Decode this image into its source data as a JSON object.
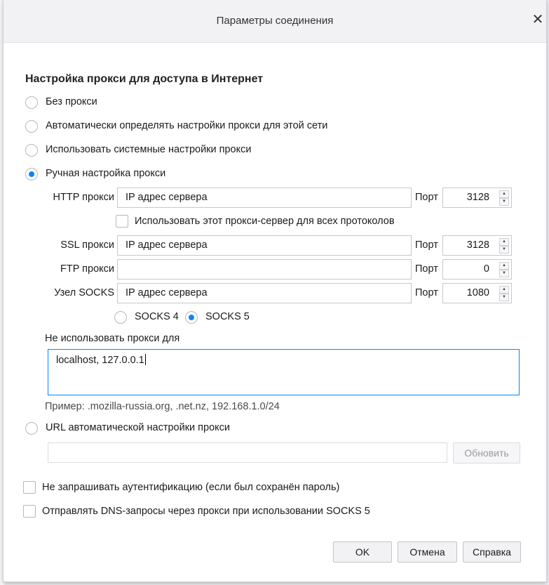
{
  "dialog": {
    "title": "Параметры соединения",
    "close": "✕"
  },
  "heading": "Настройка прокси для доступа в Интернет",
  "proxy_modes": [
    {
      "label": "Без прокси",
      "checked": false
    },
    {
      "label": "Автоматически определять настройки прокси для этой сети",
      "checked": false
    },
    {
      "label": "Использовать системные настройки прокси",
      "checked": false
    },
    {
      "label": "Ручная настройка прокси",
      "checked": true
    }
  ],
  "manual": {
    "http": {
      "label": "HTTP прокси",
      "value": "IP адрес сервера",
      "port_label": "Порт",
      "port": "3128"
    },
    "share_all": {
      "label": "Использовать этот прокси-сервер для всех протоколов",
      "checked": false
    },
    "ssl": {
      "label": "SSL прокси",
      "value": "IP адрес сервера",
      "port_label": "Порт",
      "port": "3128"
    },
    "ftp": {
      "label": "FTP прокси",
      "value": "",
      "port_label": "Порт",
      "port": "0"
    },
    "socks": {
      "label": "Узел SOCKS",
      "value": "IP адрес сервера",
      "port_label": "Порт",
      "port": "1080"
    },
    "socks4": {
      "label": "SOCKS 4",
      "checked": false
    },
    "socks5": {
      "label": "SOCKS 5",
      "checked": true
    }
  },
  "no_proxy": {
    "label": "Не использовать прокси для",
    "value": "localhost, 127.0.0.1",
    "example": "Пример: .mozilla-russia.org, .net.nz, 192.168.1.0/24"
  },
  "autoconfig": {
    "label": "URL автоматической настройки прокси",
    "checked": false,
    "value": "",
    "reload": "Обновить"
  },
  "no_auth_prompt": {
    "label": "Не запрашивать аутентификацию (если был сохранён пароль)",
    "checked": false
  },
  "socks_dns": {
    "label": "Отправлять DNS-запросы через прокси при использовании SOCKS 5",
    "checked": false
  },
  "buttons": {
    "ok": "OK",
    "cancel": "Отмена",
    "help": "Справка"
  },
  "spinner": {
    "up": "▲",
    "down": "▼"
  },
  "colors": {
    "accent": "#0a84ff",
    "titlebar": "#f2f2f4"
  }
}
